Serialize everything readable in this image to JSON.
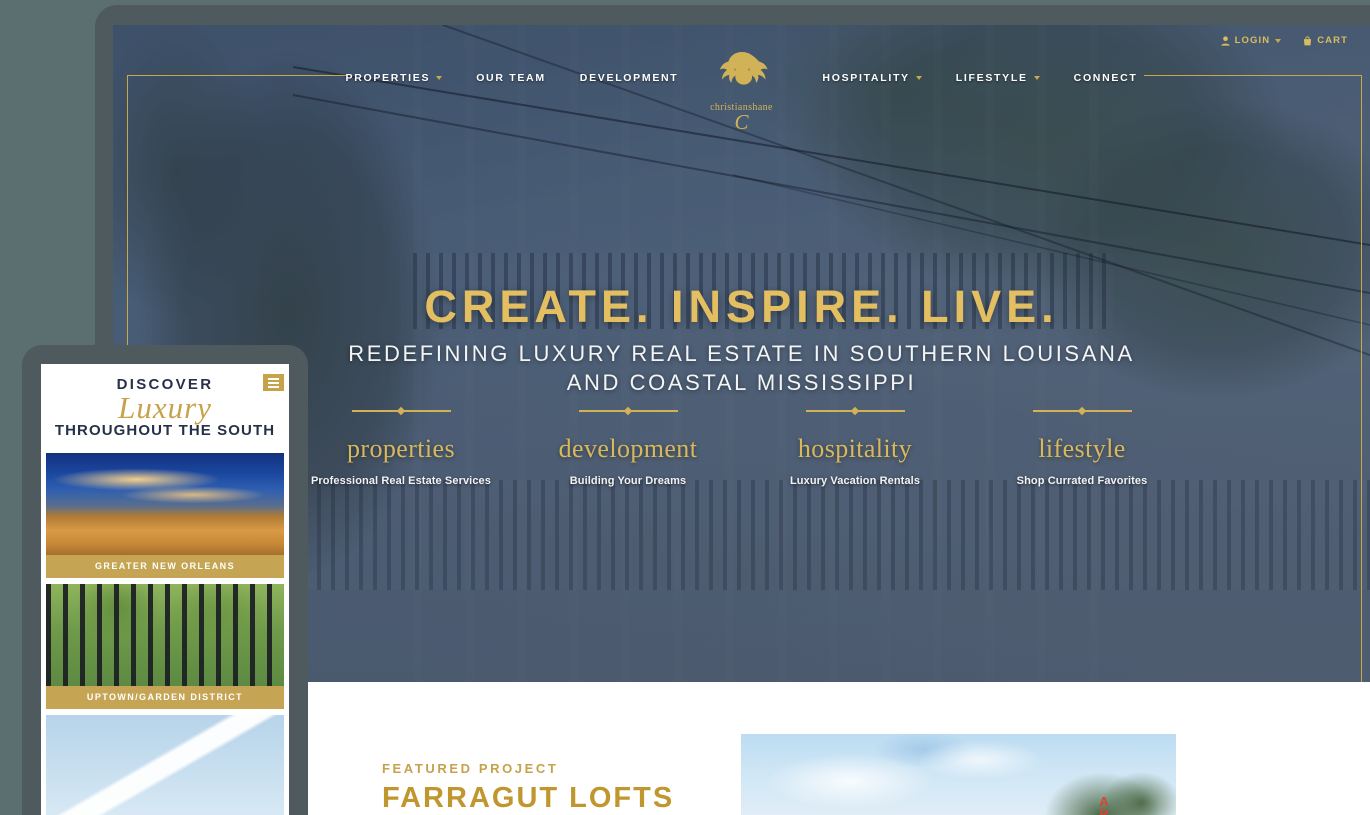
{
  "brand": {
    "wordmark": "christianshane",
    "monogram": "C",
    "logo_icon": "lion-head-logo",
    "gold": "#c8a84b",
    "navy": "#26314a"
  },
  "utility_bar": {
    "login_label": "LOGIN",
    "login_icon": "user-icon",
    "login_caret_icon": "chevron-down-icon",
    "cart_label": "CART",
    "cart_icon": "shopping-bag-icon"
  },
  "nav": {
    "left_items": [
      {
        "label": "PROPERTIES",
        "has_dropdown": true
      },
      {
        "label": "OUR TEAM",
        "has_dropdown": false
      },
      {
        "label": "DEVELOPMENT",
        "has_dropdown": false
      }
    ],
    "right_items": [
      {
        "label": "HOSPITALITY",
        "has_dropdown": true
      },
      {
        "label": "LIFESTYLE",
        "has_dropdown": true
      },
      {
        "label": "CONNECT",
        "has_dropdown": false
      }
    ]
  },
  "hero": {
    "title": "CREATE. INSPIRE. LIVE.",
    "subtitle_line1": "REDEFINING LUXURY REAL ESTATE IN SOUTHERN LOUISANA",
    "subtitle_line2": "AND COASTAL MISSISSIPPI"
  },
  "categories": [
    {
      "name": "properties",
      "desc": "Professional Real Estate Services"
    },
    {
      "name": "development",
      "desc": "Building Your Dreams"
    },
    {
      "name": "hospitality",
      "desc": "Luxury Vacation Rentals"
    },
    {
      "name": "lifestyle",
      "desc": "Shop Currated Favorites"
    }
  ],
  "featured": {
    "kicker": "FEATURED PROJECT",
    "title": "FARRAGUT LOFTS",
    "photo_sign_line1": "A",
    "photo_sign_line2": "R"
  },
  "mobile": {
    "heading_top": "DISCOVER",
    "heading_script": "Luxury",
    "heading_bottom": "THROUGHOUT THE SOUTH",
    "menu_icon": "hamburger-menu-icon",
    "cards": [
      {
        "label": "GREATER NEW ORLEANS",
        "image": "new-orleans-bridge-skyline-photo"
      },
      {
        "label": "UPTOWN/GARDEN DISTRICT",
        "image": "iron-fence-garden-photo"
      },
      {
        "label": "",
        "image": "sailboat-sky-photo"
      }
    ]
  }
}
